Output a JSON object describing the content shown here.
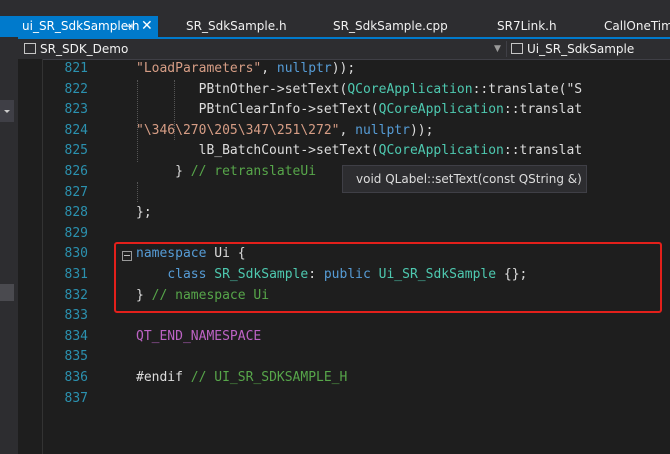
{
  "tabs": [
    {
      "label": "ui_SR_SdkSample.h",
      "active": true
    },
    {
      "label": "SR_SdkSample.h"
    },
    {
      "label": "SR_SdkSample.cpp"
    },
    {
      "label": "SR7Link.h"
    },
    {
      "label": "CallOneTim"
    }
  ],
  "tab_pin_icon": "pin-icon",
  "tab_close_icon": "close-icon",
  "navbar": {
    "project": "SR_SDK_Demo",
    "class": "Ui_SR_SdkSample"
  },
  "line_numbers": [
    "821",
    "822",
    "823",
    "824",
    "825",
    "826",
    "827",
    "828",
    "829",
    "830",
    "831",
    "832",
    "833",
    "834",
    "835",
    "836",
    "837"
  ],
  "tooltip": "void QLabel::setText(const QString &)",
  "colors": {
    "accent": "#007acc",
    "highlight_border": "#e3201b",
    "keyword": "#569cd6",
    "string": "#d69d85",
    "comment": "#57a64a",
    "macro": "#bd63c5",
    "class": "#4ec9b0",
    "line_number": "#2b91af"
  }
}
